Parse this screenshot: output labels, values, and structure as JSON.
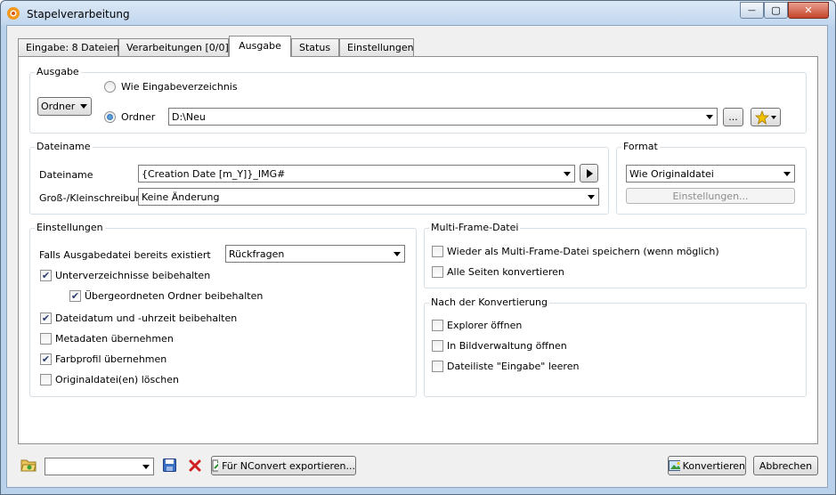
{
  "window": {
    "title": "Stapelverarbeitung",
    "controls": {
      "minimize": "—",
      "maximize": "▢",
      "close": "✕"
    }
  },
  "tabs": [
    {
      "label": "Eingabe: 8 Dateien",
      "active": false
    },
    {
      "label": "Verarbeitungen [0/0]",
      "active": false
    },
    {
      "label": "Ausgabe",
      "active": true
    },
    {
      "label": "Status",
      "active": false
    },
    {
      "label": "Einstellungen",
      "active": false
    }
  ],
  "ausgabe": {
    "title": "Ausgabe",
    "mode_select": "Ordner",
    "radio_same_dir": {
      "label": "Wie Eingabeverzeichnis",
      "checked": false
    },
    "radio_folder": {
      "label": "Ordner",
      "checked": true
    },
    "folder_path": "D:\\Neu",
    "browse_label": "...",
    "favorites_icon": "star-icon"
  },
  "dateiname": {
    "title": "Dateiname",
    "name_label": "Dateiname",
    "name_value": "{Creation Date [m_Y]}_IMG#",
    "case_label": "Groß-/Kleinschreibung",
    "case_value": "Keine Änderung",
    "play_icon": "play-icon"
  },
  "format": {
    "title": "Format",
    "value": "Wie Originaldatei",
    "settings_button": "Einstellungen..."
  },
  "einstellungen": {
    "title": "Einstellungen",
    "exists_label": "Falls Ausgabedatei bereits existiert",
    "exists_value": "Rückfragen",
    "checkboxes": [
      {
        "label": "Unterverzeichnisse beibehalten",
        "checked": true
      },
      {
        "label": "Übergeordneten Ordner beibehalten",
        "checked": true
      },
      {
        "label": "Dateidatum und -uhrzeit beibehalten",
        "checked": true
      },
      {
        "label": "Metadaten übernehmen",
        "checked": false
      },
      {
        "label": "Farbprofil übernehmen",
        "checked": true
      },
      {
        "label": "Originaldatei(en) löschen",
        "checked": false
      }
    ]
  },
  "multiframe": {
    "title": "Multi-Frame-Datei",
    "checkboxes": [
      {
        "label": "Wieder als Multi-Frame-Datei speichern (wenn möglich)",
        "checked": false
      },
      {
        "label": "Alle Seiten konvertieren",
        "checked": false
      }
    ]
  },
  "nach": {
    "title": "Nach der Konvertierung",
    "checkboxes": [
      {
        "label": "Explorer öffnen",
        "checked": false
      },
      {
        "label": "In Bildverwaltung öffnen",
        "checked": false
      },
      {
        "label": "Dateiliste \"Eingabe\" leeren",
        "checked": false
      }
    ]
  },
  "footer": {
    "preset_value": "",
    "export_label": "Für NConvert exportieren...",
    "convert_label": "Konvertieren",
    "cancel_label": "Abbrechen"
  },
  "colors": {
    "check_mark": "#2a3a6a",
    "delete_red": "#d02020",
    "star_gold": "#f2c200"
  }
}
